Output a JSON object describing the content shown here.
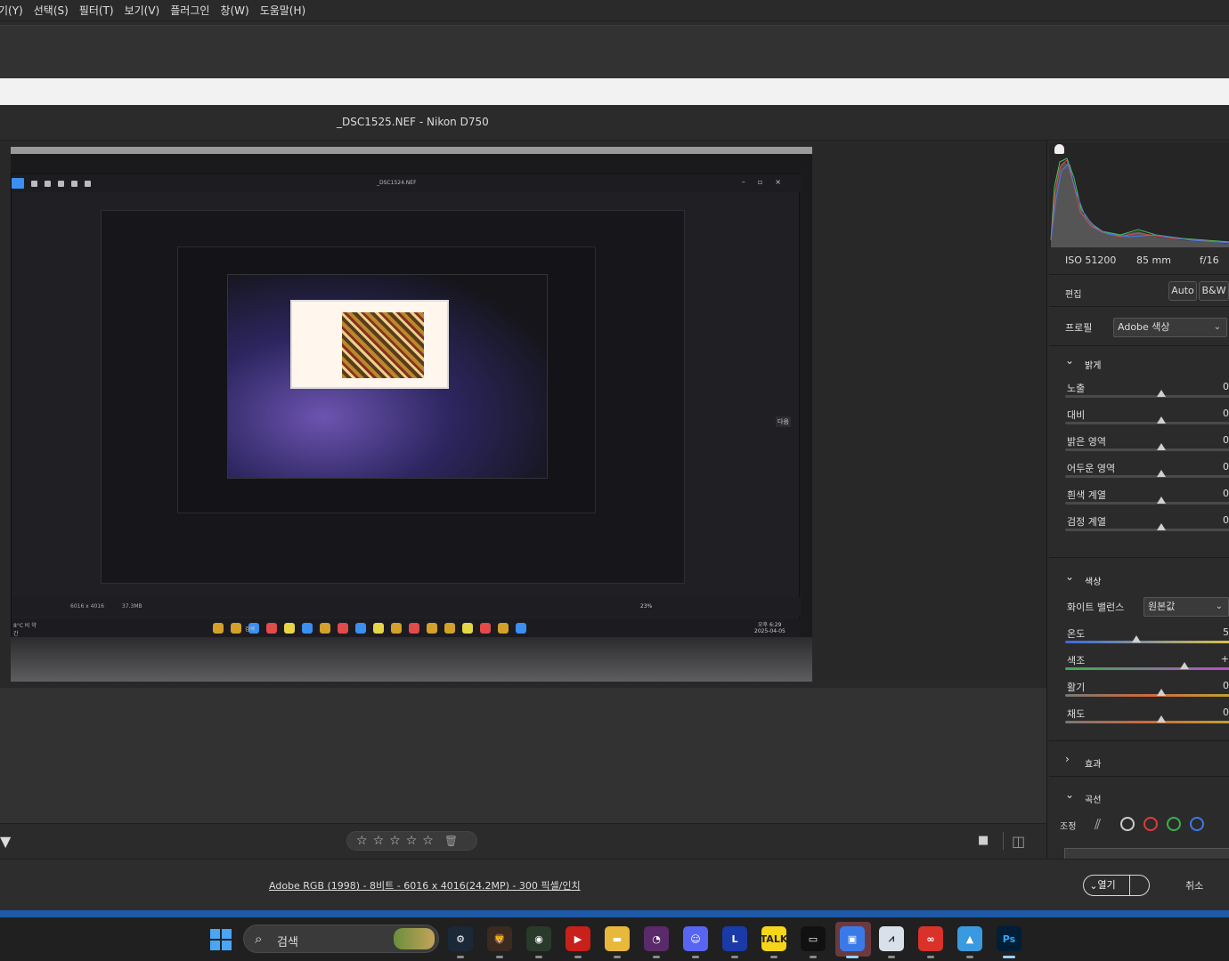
{
  "menubar": {
    "items": [
      "기(Y)",
      "선택(S)",
      "필터(T)",
      "보기(V)",
      "플러그인",
      "창(W)",
      "도움말(H)"
    ]
  },
  "dialog": {
    "title": "_DSC1525.NEF  -  Nikon D750"
  },
  "photo": {
    "screen_title": "_DSC1524.NEF",
    "status_dims": "6016 x 4016",
    "status_size": "37.3MB",
    "zoom": "23%",
    "clock_time": "오후 6:29",
    "clock_date": "2025-04-05",
    "taskbar_search": "검색",
    "weather": "8°C 비 약간",
    "next_label": "다음"
  },
  "filmstrip": {
    "rating_stars": [
      "☆",
      "☆",
      "☆",
      "☆",
      "☆"
    ],
    "trash_icon": "trash-icon"
  },
  "info": {
    "workflow_link": "Adobe RGB (1998) - 8비트 - 6016 x 4016(24.2MP) - 300 픽셀/인치",
    "open_label": "열기",
    "open_arrow": "⌄",
    "cancel_label": "취소"
  },
  "panel": {
    "exif": {
      "iso": "ISO 51200",
      "focal": "85 mm",
      "aperture": "f/16"
    },
    "edit_label": "편집",
    "auto_label": "Auto",
    "bw_label": "B&W",
    "profile_label": "프로필",
    "profile_value": "Adobe 색상",
    "light": {
      "title": "밝게",
      "sliders": [
        {
          "label": "노출",
          "value": "0",
          "pos": 0.5
        },
        {
          "label": "대비",
          "value": "0",
          "pos": 0.5
        },
        {
          "label": "밝은 영역",
          "value": "0",
          "pos": 0.5
        },
        {
          "label": "어두운 영역",
          "value": "0",
          "pos": 0.5
        },
        {
          "label": "흰색 계열",
          "value": "0",
          "pos": 0.5
        },
        {
          "label": "검정 계열",
          "value": "0",
          "pos": 0.5
        }
      ]
    },
    "color": {
      "title": "색상",
      "wb_label": "화이트 밸런스",
      "wb_value": "원본값",
      "sliders": [
        {
          "label": "온도",
          "value": "5",
          "pos": 0.37
        },
        {
          "label": "색조",
          "value": "+",
          "pos": 0.62
        },
        {
          "label": "활기",
          "value": "0",
          "pos": 0.5
        },
        {
          "label": "채도",
          "value": "0",
          "pos": 0.5
        }
      ]
    },
    "effects_title": "효과",
    "curve_title": "곡선",
    "adjust_label": "조정"
  },
  "taskbar": {
    "search_text": "검색",
    "apps": [
      "steam",
      "brave",
      "chrome",
      "youtube-music",
      "file-explorer",
      "firefox",
      "discord",
      "line",
      "kakaotalk",
      "terminal",
      "active-app",
      "resource-monitor",
      "creative-cloud",
      "photos",
      "photoshop"
    ]
  },
  "colors": {
    "accent_blue": "#1e5aa8",
    "panel_bg": "#2b2b2b",
    "canvas_bg": "#282828"
  }
}
